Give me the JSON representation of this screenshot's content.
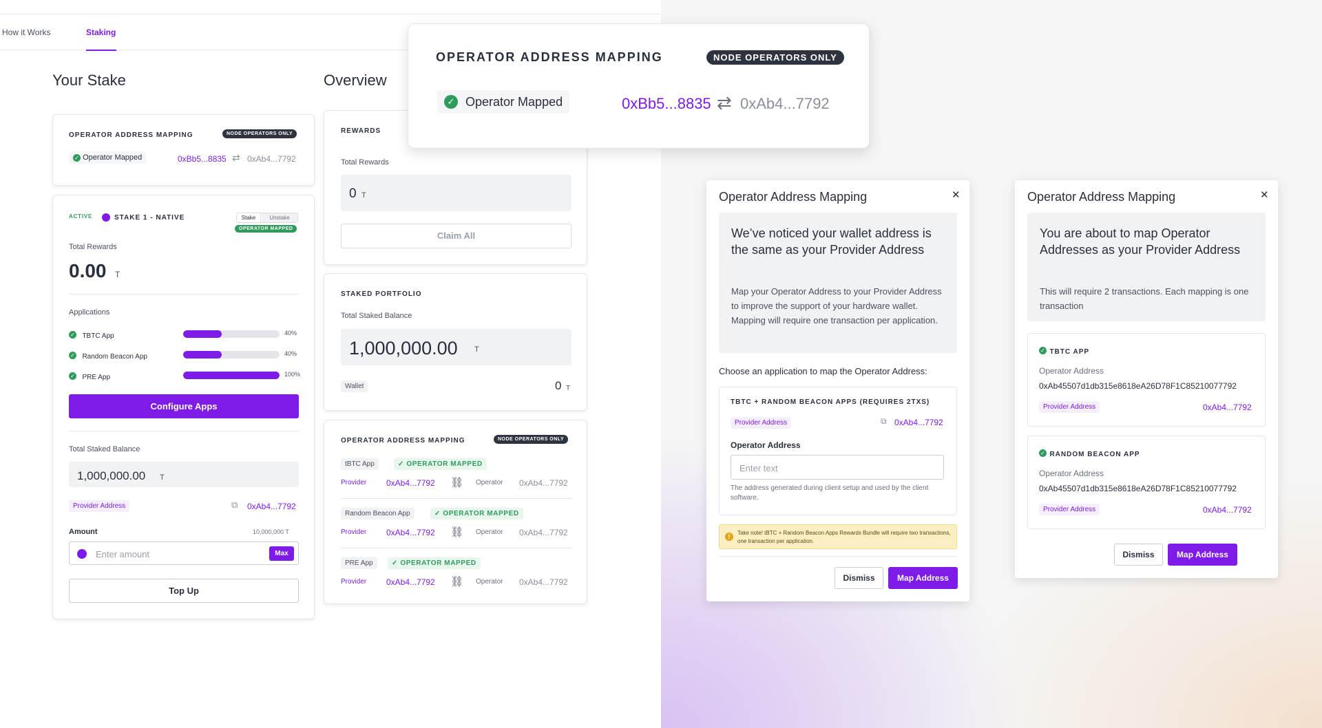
{
  "nav": {
    "items": [
      "How it Works",
      "Staking"
    ],
    "active": "Staking"
  },
  "left": {
    "your_stake_title": "Your Stake",
    "overview_title": "Overview",
    "mapping_card": {
      "title": "OPERATOR ADDRESS MAPPING",
      "badge": "NODE OPERATORS ONLY",
      "status": "Operator Mapped",
      "from_address": "0xBb5...8835",
      "to_address": "0xAb4...7792"
    },
    "stake_card": {
      "active_badge": "ACTIVE",
      "stake_name": "STAKE 1 - NATIVE",
      "tab_stake": "Stake",
      "tab_unstake": "Unstake",
      "mapped_badge": "OPERATOR MAPPED",
      "total_rewards_label": "Total Rewards",
      "total_rewards_value": "0.00",
      "token": "T",
      "applications_label": "Applications",
      "apps": [
        {
          "name": "TBTC App",
          "percent_label": "40%",
          "fill": 0.4
        },
        {
          "name": "Random Beacon App",
          "percent_label": "40%",
          "fill": 0.4
        },
        {
          "name": "PRE App",
          "percent_label": "100%",
          "fill": 1.0
        }
      ],
      "configure_button": "Configure Apps",
      "total_staked_label": "Total Staked Balance",
      "total_staked_value": "1,000,000.00",
      "provider_address_label": "Provider Address",
      "provider_address": "0xAb4...7792",
      "amount_label": "Amount",
      "amount_max_value": "10,000,000 T",
      "amount_placeholder": "Enter amount",
      "max_button": "Max",
      "top_up_button": "Top Up"
    },
    "rewards_card": {
      "title": "REWARDS",
      "total_rewards_label": "Total Rewards",
      "total_rewards_value": "0",
      "token": "T",
      "claim_button": "Claim All"
    },
    "portfolio_card": {
      "title": "STAKED PORTFOLIO",
      "total_staked_label": "Total Staked Balance",
      "total_staked_value": "1,000,000.00",
      "token": "T",
      "wallet_label": "Wallet",
      "wallet_value": "0"
    },
    "overview_mapping_card": {
      "title": "OPERATOR ADDRESS MAPPING",
      "badge": "NODE OPERATORS ONLY",
      "rows": [
        {
          "app": "tBTC App",
          "status": "OPERATOR MAPPED",
          "provider_label": "Provider",
          "provider": "0xAb4...7792",
          "operator_label": "Operator",
          "operator": "0xAb4...7792"
        },
        {
          "app": "Random Beacon App",
          "status": "OPERATOR MAPPED",
          "provider_label": "Provider",
          "provider": "0xAb4...7792",
          "operator_label": "Operator",
          "operator": "0xAb4...7792"
        },
        {
          "app": "PRE App",
          "status": "OPERATOR MAPPED",
          "provider_label": "Provider",
          "provider": "0xAb4...7792",
          "operator_label": "Operator",
          "operator": "0xAb4...7792"
        }
      ]
    }
  },
  "zoom_card": {
    "title": "OPERATOR ADDRESS MAPPING",
    "badge": "NODE OPERATORS ONLY",
    "status": "Operator Mapped",
    "from_address": "0xBb5...8835",
    "to_address": "0xAb4...7792"
  },
  "modal1": {
    "title": "Operator Address Mapping",
    "headline": "We’ve noticed your wallet address is the same as your Provider Address",
    "body": "Map your Operator Address to your Provider Address to improve the support of your hardware wallet. Mapping will require one transaction per application.",
    "choose_label": "Choose an application to map the Operator Address:",
    "app_title": "TBTC  + RANDOM BEACON APPS (REQUIRES 2TXS)",
    "provider_label": "Provider Address",
    "provider_address": "0xAb4...7792",
    "operator_label": "Operator Address",
    "operator_placeholder": "Enter text",
    "helper": "The address generated during client setup and used by the client software.",
    "warning": "Take note! tBTC + Random Beacon Apps Rewards Bundle will require two transactions, one transaction per application.",
    "dismiss": "Dismiss",
    "map": "Map Address"
  },
  "modal2": {
    "title": "Operator Address Mapping",
    "headline": "You are about to map Operator Addresses as your Provider Address",
    "body": "This will require 2 transactions. Each mapping is one transaction",
    "apps": [
      {
        "name": "TBTC APP",
        "operator_label": "Operator Address",
        "operator_address": "0xAb45507d1db315e8618eA26D78F1C85210077792",
        "provider_label": "Provider Address",
        "provider_address": "0xAb4...7792"
      },
      {
        "name": "RANDOM BEACON APP",
        "operator_label": "Operator Address",
        "operator_address": "0xAb45507d1db315e8618eA26D78F1C85210077792",
        "provider_label": "Provider Address",
        "provider_address": "0xAb4...7792"
      }
    ],
    "dismiss": "Dismiss",
    "map": "Map Address"
  },
  "colors": {
    "accent": "#7e1be8",
    "success": "#2f9b5d",
    "dark_badge": "#2e3340"
  }
}
